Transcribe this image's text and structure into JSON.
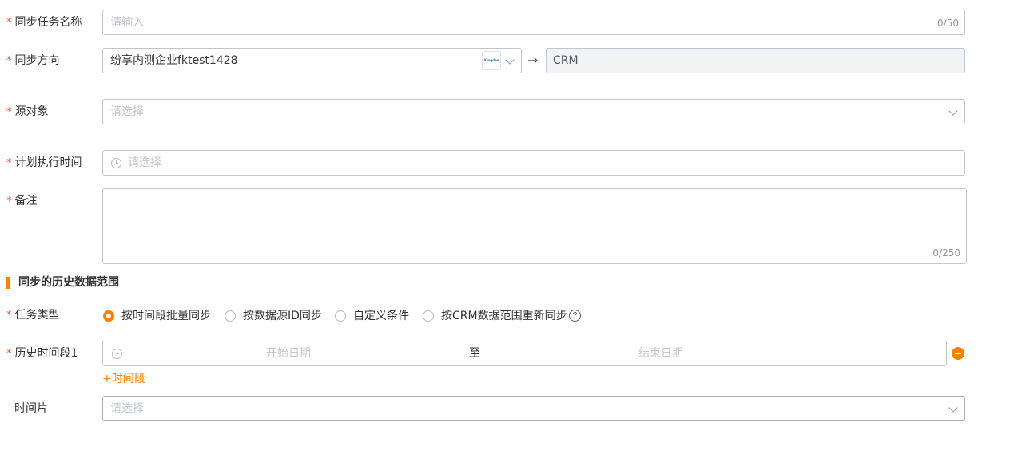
{
  "form": {
    "task_name": {
      "label": "同步任务名称",
      "placeholder": "请输入",
      "count": "0/50"
    },
    "direction": {
      "label": "同步方向",
      "source_value": "纷享内测企业fktest1428",
      "source_logo": "Kingdee",
      "target_value": "CRM"
    },
    "source_object": {
      "label": "源对象",
      "placeholder": "请选择"
    },
    "schedule_time": {
      "label": "计划执行时间",
      "placeholder": "请选择"
    },
    "remark": {
      "label": "备注",
      "count": "0/250"
    }
  },
  "history": {
    "section_title": "同步的历史数据范围",
    "task_type": {
      "label": "任务类型",
      "options": [
        {
          "label": "按时间段批量同步",
          "selected": true
        },
        {
          "label": "按数据源ID同步",
          "selected": false
        },
        {
          "label": "自定义条件",
          "selected": false
        },
        {
          "label": "按CRM数据范围重新同步",
          "selected": false
        }
      ],
      "help_icon": "question-circle-icon"
    },
    "period": {
      "label": "历史时间段1",
      "start_placeholder": "开始日期",
      "separator": "至",
      "end_placeholder": "结束日期",
      "add_label": "+时间段"
    },
    "time_slice": {
      "label": "时间片",
      "placeholder": "请选择"
    }
  },
  "colors": {
    "accent": "#ff8000",
    "required": "#ff522a",
    "border": "#c1c5ce",
    "disabled_bg": "#f2f3f5",
    "remove": "#ff8000"
  }
}
